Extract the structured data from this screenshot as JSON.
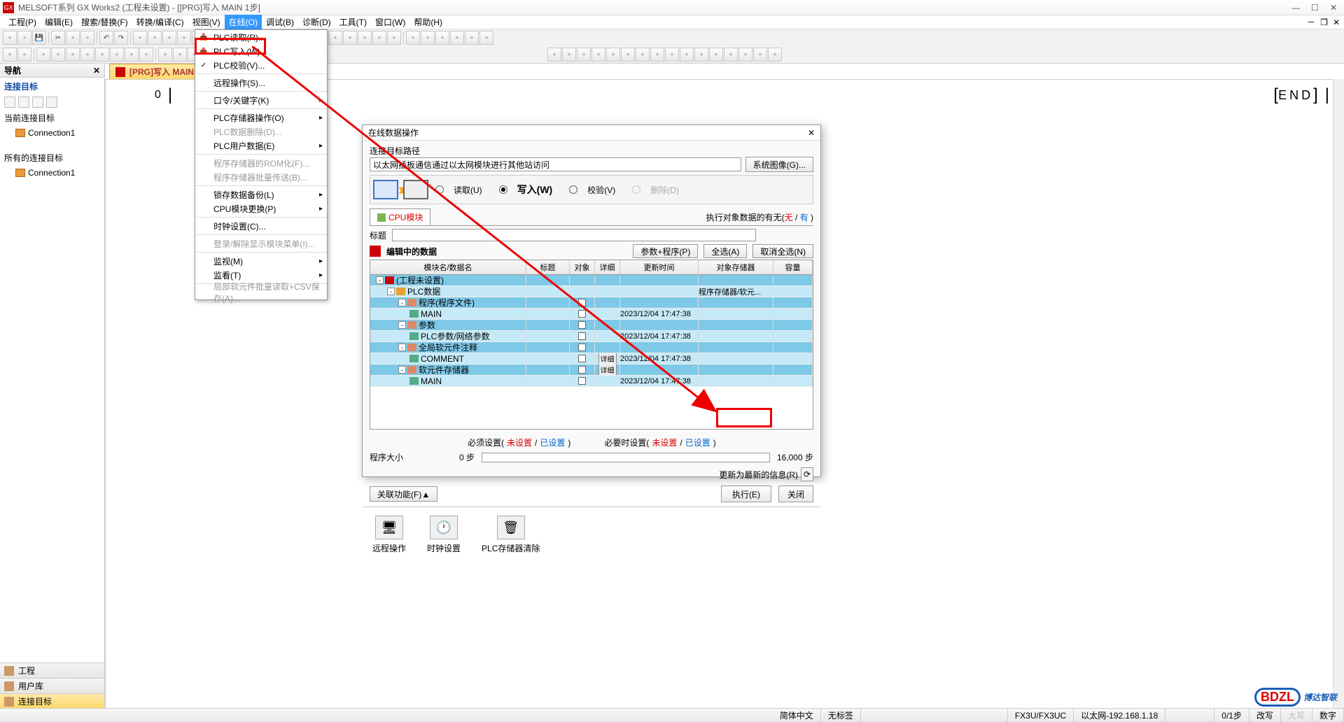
{
  "titlebar": {
    "text": "MELSOFT系列 GX Works2 (工程未设置) - [[PRG]写入 MAIN 1步]"
  },
  "menubar": {
    "items": [
      "工程(P)",
      "编辑(E)",
      "搜索/替换(F)",
      "转换/编译(C)",
      "视图(V)",
      "在线(O)",
      "调试(B)",
      "诊断(D)",
      "工具(T)",
      "窗口(W)",
      "帮助(H)"
    ]
  },
  "nav": {
    "header": "导航",
    "target_label": "连接目标",
    "current_label": "当前连接目标",
    "all_label": "所有的连接目标",
    "connection": "Connection1",
    "tabs": [
      "工程",
      "用户库",
      "连接目标"
    ]
  },
  "doc_tab": "[PRG]写入 MAIN 1...",
  "ladder": {
    "step": "0",
    "end": "END"
  },
  "dropdown": {
    "items": [
      {
        "label": "PLC读取(R)...",
        "disabled": false
      },
      {
        "label": "PLC写入(W)...",
        "disabled": false,
        "highlight": true
      },
      {
        "label": "PLC校验(V)...",
        "disabled": false
      },
      {
        "label": "远程操作(S)...",
        "arrow": false
      },
      {
        "label": "口令/关键字(K)",
        "arrow": true
      },
      {
        "label": "PLC存储器操作(O)",
        "arrow": true
      },
      {
        "label": "PLC数据删除(D)...",
        "disabled": true
      },
      {
        "label": "PLC用户数据(E)",
        "arrow": true
      },
      {
        "label": "程序存储器的ROM化(F)...",
        "disabled": true
      },
      {
        "label": "程序存储器批量传送(B)...",
        "disabled": true
      },
      {
        "label": "锁存数据备份(L)",
        "arrow": true
      },
      {
        "label": "CPU模块更换(P)",
        "arrow": true
      },
      {
        "label": "时钟设置(C)...",
        "disabled": false
      },
      {
        "label": "登录/解除显示模块菜单(I)...",
        "disabled": true
      },
      {
        "label": "监视(M)",
        "arrow": true
      },
      {
        "label": "监看(T)",
        "arrow": true
      },
      {
        "label": "局部软元件批量读取+CSV保存(A)...",
        "disabled": true
      }
    ]
  },
  "dialog": {
    "title": "在线数据操作",
    "path_label": "连接目标路径",
    "path_value": "以太网插板通信通过以太网模块进行其他站访问",
    "system_img_btn": "系统图像(G)...",
    "modes": {
      "read": "读取(U)",
      "write": "写入(W)",
      "verify": "校验(V)",
      "delete": "删除(D)"
    },
    "tab_cpu": "CPU模块",
    "exec_status": {
      "prefix": "执行对象数据的有无(",
      "none": "无",
      "sep": " / ",
      "have": "有",
      "suffix": " )"
    },
    "title_label": "标题",
    "data_bar": {
      "lbl": "编辑中的数据",
      "param": "参数+程序(P)",
      "all": "全选(A)",
      "none": "取消全选(N)"
    },
    "table": {
      "headers": [
        "模块名/数据名",
        "标题",
        "对象",
        "详细",
        "更新时间",
        "对象存储器",
        "容量"
      ],
      "rows": [
        {
          "name": "(工程未设置)",
          "depth": 0,
          "dark": true,
          "toggle": "-",
          "ico": "#c00"
        },
        {
          "name": "PLC数据",
          "depth": 1,
          "light": true,
          "toggle": "-",
          "ico": "#e8a030",
          "store": "程序存储器/软元..."
        },
        {
          "name": "程序(程序文件)",
          "depth": 2,
          "dark": true,
          "toggle": "-",
          "ico": "#d86",
          "chk": true
        },
        {
          "name": "MAIN",
          "depth": 3,
          "light": true,
          "ico": "#5a8",
          "chk": true,
          "date": "2023/12/04 17:47:38"
        },
        {
          "name": "参数",
          "depth": 2,
          "dark": true,
          "toggle": "-",
          "ico": "#d86",
          "chk": true
        },
        {
          "name": "PLC参数/网络参数",
          "depth": 3,
          "light": true,
          "ico": "#5a8",
          "chk": true,
          "date": "2023/12/04 17:47:38"
        },
        {
          "name": "全局软元件注释",
          "depth": 2,
          "dark": true,
          "toggle": "-",
          "ico": "#d86",
          "chk": true
        },
        {
          "name": "COMMENT",
          "depth": 3,
          "light": true,
          "ico": "#5a8",
          "chk": true,
          "detail": "详细",
          "date": "2023/12/04 17:47:38"
        },
        {
          "name": "软元件存储器",
          "depth": 2,
          "dark": true,
          "toggle": "-",
          "ico": "#d86",
          "chk": true,
          "detail": "详细"
        },
        {
          "name": "MAIN",
          "depth": 3,
          "light": true,
          "ico": "#5a8",
          "chk": true,
          "date": "2023/12/04 17:47:38"
        }
      ]
    },
    "legend": {
      "must": "必须设置(",
      "notset": "未设置",
      "sep": " / ",
      "set": "已设置",
      "close": " )",
      "opt": "必要时设置("
    },
    "size": {
      "label": "程序大小",
      "val": "0 步",
      "total": "16,000 步"
    },
    "refresh": "更新为最新的信息(R)",
    "related": "关联功能(F)▲",
    "exec": "执行(E)",
    "close": "关闭",
    "funcs": [
      "远程操作",
      "时钟设置",
      "PLC存储器清除"
    ]
  },
  "statusbar": {
    "lang": "简体中文",
    "label": "无标签",
    "plc": "FX3U/FX3UC",
    "net": "以太网-192.168.1.18",
    "step": "0/1步",
    "mode": "改写",
    "caps": "大写",
    "num": "数字"
  },
  "watermark": {
    "logo": "BDZL",
    "text": "博达智联"
  }
}
